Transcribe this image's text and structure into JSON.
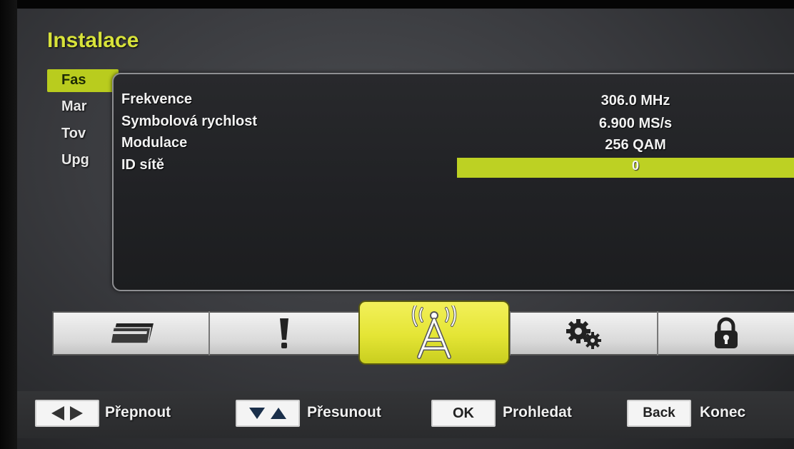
{
  "header": {
    "title": "Instalace"
  },
  "menu": {
    "items": [
      {
        "label": "Fas"
      },
      {
        "label": "Mar"
      },
      {
        "label": "Tov"
      },
      {
        "label": "Upg"
      }
    ]
  },
  "dialog": {
    "rows": [
      {
        "label": "Frekvence",
        "value": "306.0 MHz"
      },
      {
        "label": "Symbolová rychlost",
        "value": "6.900 MS/s"
      },
      {
        "label": "Modulace",
        "value": "256 QAM"
      },
      {
        "label": "ID sítě",
        "value": "0"
      }
    ]
  },
  "tabs": [
    {
      "icon": "card-icon"
    },
    {
      "icon": "exclamation-icon"
    },
    {
      "icon": "antenna-icon",
      "active": true
    },
    {
      "icon": "gears-icon"
    },
    {
      "icon": "lock-icon"
    }
  ],
  "footer": {
    "hints": [
      {
        "key_icon": "left-right-arrows-icon",
        "label": "Přepnout"
      },
      {
        "key_icon": "down-up-arrows-icon",
        "label": "Přesunout"
      },
      {
        "key": "OK",
        "label": "Prohledat"
      },
      {
        "key": "Back",
        "label": "Konec"
      }
    ]
  },
  "colors": {
    "accent": "#d7e23a",
    "highlight": "#bdd123",
    "active_tab": "#e4e535"
  }
}
